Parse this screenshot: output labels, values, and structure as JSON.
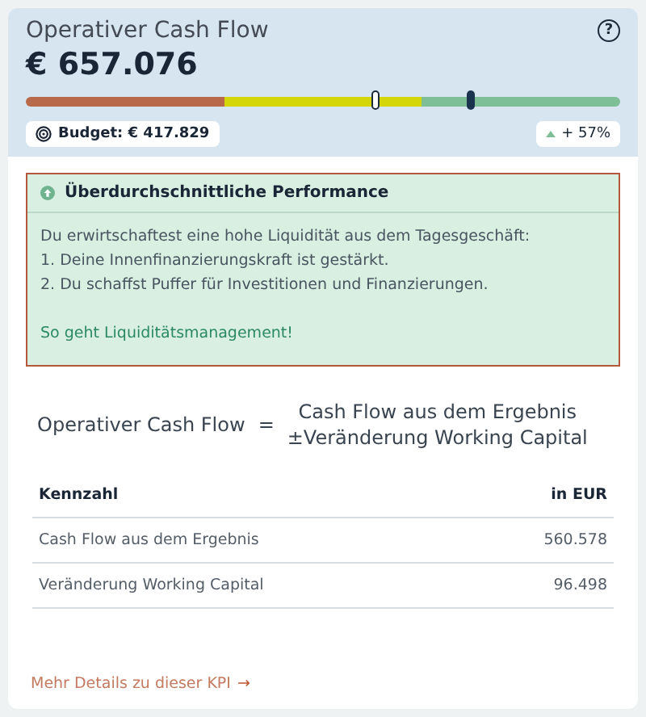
{
  "kpi": {
    "title": "Operativer Cash Flow",
    "help_icon": "?",
    "value": "€ 657.076"
  },
  "gauge": {
    "segments": [
      {
        "color": "#b8694a"
      },
      {
        "color": "#d5d60a"
      },
      {
        "color": "#7fbf98"
      }
    ],
    "markers": [
      {
        "kind": "budget",
        "level": 0.59
      },
      {
        "kind": "actual",
        "level": 0.75
      }
    ]
  },
  "budget": "Budget: € 417.829",
  "change": {
    "rising": true,
    "text": "+ 57%"
  },
  "alert": {
    "title": "Überdurchschnittliche Performance",
    "lines": [
      "Du erwirtschaftest eine hohe Liquidität aus dem Tagesgeschäft:",
      "1. Deine Innenfinanzierungskraft ist gestärkt.",
      "2. Du schaffst Puffer für Investitionen und Finanzierungen."
    ],
    "link": "So geht Liquiditätsmanagement!"
  },
  "formula": {
    "lhs": "Operativer Cash Flow",
    "equals": "=",
    "rhs": [
      "Cash Flow aus dem Ergebnis",
      "±Veränderung Working Capital"
    ]
  },
  "table": {
    "columns": [
      "Kennzahl",
      "in EUR"
    ],
    "rows": [
      [
        "Cash Flow aus dem Ergebnis",
        "560.578"
      ],
      [
        "Veränderung Working Capital",
        "96.498"
      ]
    ]
  },
  "details_link": "Mehr Details zu dieser KPI",
  "details_arrow": "→"
}
